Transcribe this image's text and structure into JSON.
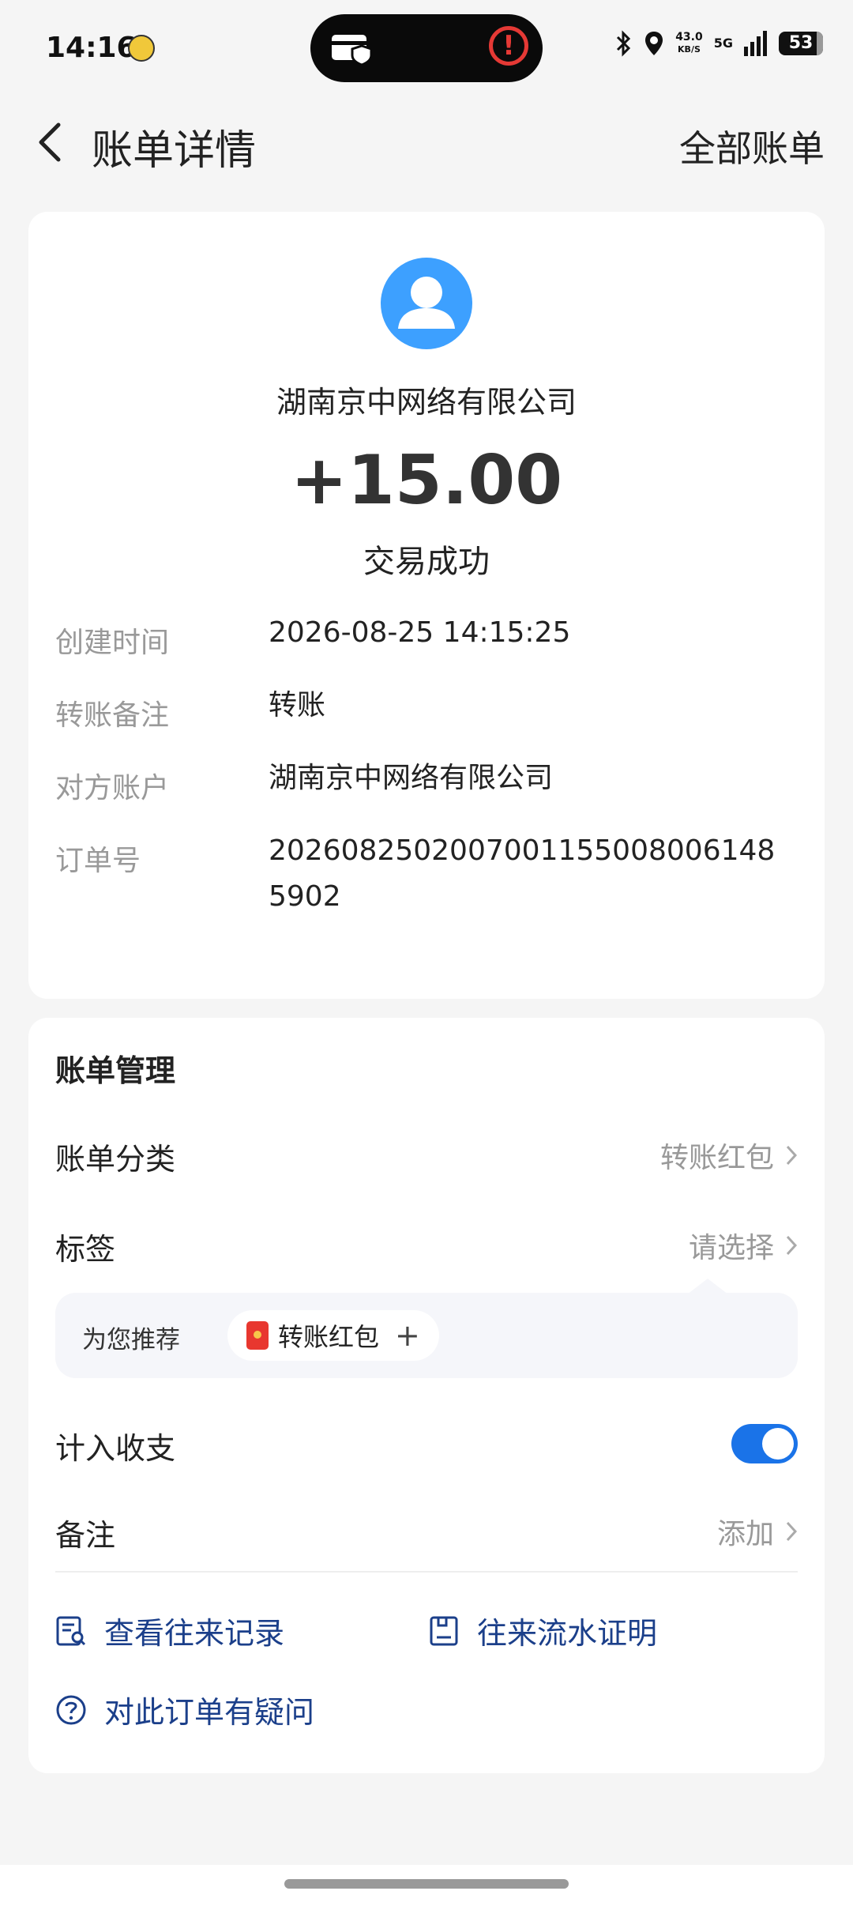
{
  "status_bar": {
    "time": "14:16",
    "net_speed_value": "43.0",
    "net_speed_unit": "KB/S",
    "network": "5G",
    "battery": "53"
  },
  "header": {
    "title": "账单详情",
    "all_bills": "全部账单"
  },
  "transaction": {
    "counterparty": "湖南京中网络有限公司",
    "amount": "+15.00",
    "status": "交易成功",
    "details": [
      {
        "label": "创建时间",
        "value": "2026-08-25 14:15:25"
      },
      {
        "label": "转账备注",
        "value": "转账"
      },
      {
        "label": "对方账户",
        "value": "湖南京中网络有限公司"
      },
      {
        "label": "订单号",
        "value": "20260825020070011550080061485902"
      }
    ]
  },
  "management": {
    "title": "账单管理",
    "category_label": "账单分类",
    "category_value": "转账红包",
    "tag_label": "标签",
    "tag_value": "请选择",
    "recommend_label": "为您推荐",
    "recommend_chip": "转账红包",
    "include_label": "计入收支",
    "include_on": true,
    "note_label": "备注",
    "note_value": "添加",
    "links": {
      "history": "查看往来记录",
      "proof": "往来流水证明",
      "question": "对此订单有疑问"
    }
  },
  "colors": {
    "accent": "#1a73e8",
    "link": "#1b3f8a",
    "avatar": "#3da0ff"
  }
}
